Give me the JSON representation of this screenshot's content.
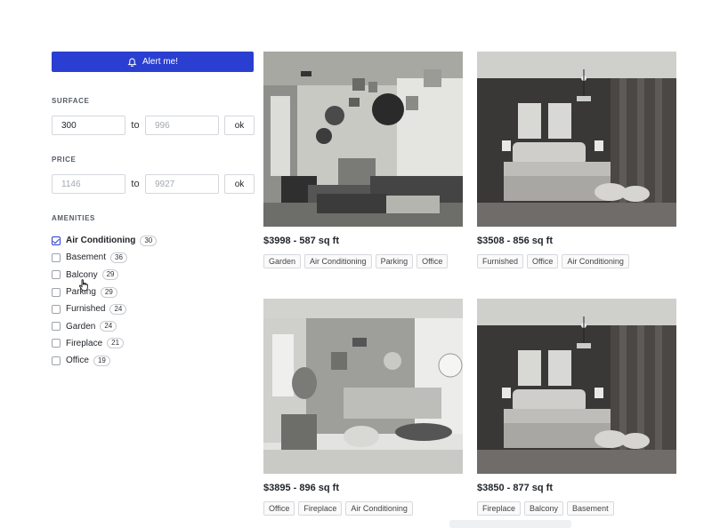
{
  "sidebar": {
    "alert_label": "Alert me!",
    "surface": {
      "title": "SURFACE",
      "min_value": "300",
      "min_placeholder": "",
      "to_label": "to",
      "max_value": "",
      "max_placeholder": "996",
      "ok_label": "ok"
    },
    "price": {
      "title": "PRICE",
      "min_value": "",
      "min_placeholder": "1146",
      "to_label": "to",
      "max_value": "",
      "max_placeholder": "9927",
      "ok_label": "ok"
    },
    "amenities": {
      "title": "AMENITIES",
      "items": [
        {
          "label": "Air Conditioning",
          "count": "30",
          "checked": true
        },
        {
          "label": "Basement",
          "count": "36",
          "checked": false
        },
        {
          "label": "Balcony",
          "count": "29",
          "checked": false
        },
        {
          "label": "Parking",
          "count": "29",
          "checked": false
        },
        {
          "label": "Furnished",
          "count": "24",
          "checked": false
        },
        {
          "label": "Garden",
          "count": "24",
          "checked": false
        },
        {
          "label": "Fireplace",
          "count": "21",
          "checked": false
        },
        {
          "label": "Office",
          "count": "19",
          "checked": false
        }
      ]
    }
  },
  "listings": [
    {
      "title": "$3998 - 587 sq ft",
      "tags": [
        "Garden",
        "Air Conditioning",
        "Parking",
        "Office"
      ],
      "image": "eclectic-living-room"
    },
    {
      "title": "$3508 - 856 sq ft",
      "tags": [
        "Furnished",
        "Office",
        "Air Conditioning"
      ],
      "image": "dark-bedroom"
    },
    {
      "title": "$3895 - 896 sq ft",
      "tags": [
        "Office",
        "Fireplace",
        "Air Conditioning"
      ],
      "image": "bright-living-room"
    },
    {
      "title": "$3850 - 877 sq ft",
      "tags": [
        "Fireplace",
        "Balcony",
        "Basement"
      ],
      "image": "dark-bedroom"
    }
  ],
  "colors": {
    "accent": "#2a3fd1"
  },
  "icons": {
    "alert": "bell-icon",
    "cursor": "hand-pointer-icon"
  }
}
